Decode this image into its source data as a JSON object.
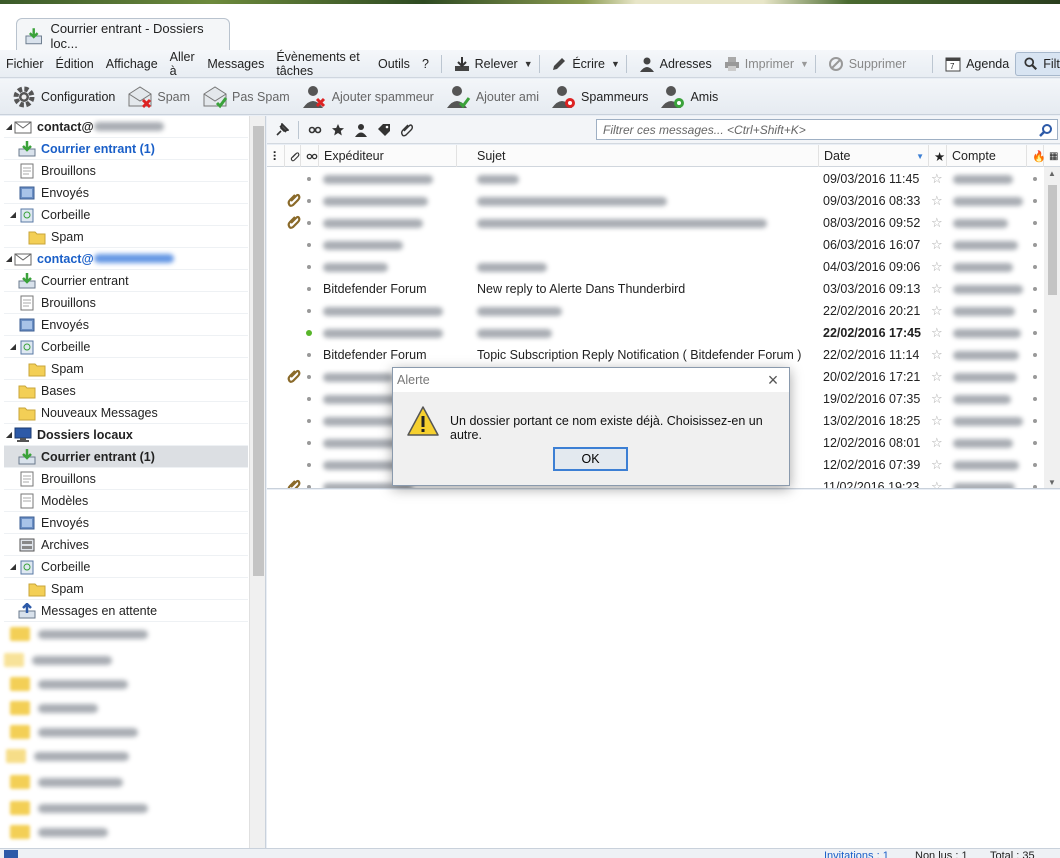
{
  "window": {
    "tab_title": "Courrier entrant - Dossiers loc..."
  },
  "menu": [
    "Fichier",
    "Édition",
    "Affichage",
    "Aller à",
    "Messages",
    "Évènements et tâches",
    "Outils",
    "?"
  ],
  "toolbar": {
    "get_mail": "Relever",
    "write": "Écrire",
    "address_book": "Adresses",
    "print": "Imprimer",
    "delete": "Supprimer",
    "calendar": "Agenda",
    "filter": "Filtre"
  },
  "ext_toolbar": {
    "config": "Configuration",
    "spam": "Spam",
    "not_spam": "Pas Spam",
    "add_spammer": "Ajouter spammeur",
    "add_friend": "Ajouter ami",
    "spammers": "Spammeurs",
    "friends": "Amis"
  },
  "folders": {
    "account1_prefix": "contact@",
    "account2_prefix": "contact@",
    "acc1_inbox": "Courrier entrant (1)",
    "acc1_drafts": "Brouillons",
    "acc1_sent": "Envoyés",
    "acc1_trash": "Corbeille",
    "acc1_spam": "Spam",
    "acc2_inbox": "Courrier entrant",
    "acc2_drafts": "Brouillons",
    "acc2_sent": "Envoyés",
    "acc2_trash": "Corbeille",
    "acc2_spam": "Spam",
    "acc2_bases": "Bases",
    "acc2_newmsgs": "Nouveaux Messages",
    "local": "Dossiers locaux",
    "local_inbox": "Courrier entrant (1)",
    "local_drafts": "Brouillons",
    "local_templates": "Modèles",
    "local_sent": "Envoyés",
    "local_archives": "Archives",
    "local_trash": "Corbeille",
    "local_spam": "Spam",
    "local_outbox": "Messages en attente"
  },
  "search": {
    "placeholder": "Filtrer ces messages... <Ctrl+Shift+K>"
  },
  "columns": {
    "sender": "Expéditeur",
    "subject": "Sujet",
    "date": "Date",
    "account": "Compte"
  },
  "messages": [
    {
      "sender": "",
      "subject": "",
      "date": "09/03/2016 11:45",
      "attach": false,
      "unread": false
    },
    {
      "sender": "",
      "subject": "",
      "date": "09/03/2016 08:33",
      "attach": true,
      "unread": false
    },
    {
      "sender": "",
      "subject": "",
      "date": "08/03/2016 09:52",
      "attach": true,
      "unread": false
    },
    {
      "sender": "",
      "subject": "",
      "date": "06/03/2016 16:07",
      "attach": false,
      "unread": false
    },
    {
      "sender": "",
      "subject": "",
      "date": "04/03/2016 09:06",
      "attach": false,
      "unread": false
    },
    {
      "sender": "Bitdefender Forum",
      "subject": "New reply to Alerte Dans Thunderbird",
      "date": "03/03/2016 09:13",
      "attach": false,
      "unread": false
    },
    {
      "sender": "",
      "subject": "",
      "date": "22/02/2016 20:21",
      "attach": false,
      "unread": false
    },
    {
      "sender": "",
      "subject": "",
      "date": "22/02/2016 17:45",
      "attach": false,
      "unread": true
    },
    {
      "sender": "Bitdefender Forum",
      "subject": "Topic Subscription Reply Notification ( Bitdefender Forum )",
      "date": "22/02/2016 11:14",
      "attach": false,
      "unread": false
    },
    {
      "sender": "",
      "subject": "",
      "date": "20/02/2016 17:21",
      "attach": true,
      "unread": false
    },
    {
      "sender": "",
      "subject": "",
      "date": "19/02/2016 07:35",
      "attach": false,
      "unread": false
    },
    {
      "sender": "",
      "subject": "",
      "date": "13/02/2016 18:25",
      "attach": false,
      "unread": false
    },
    {
      "sender": "",
      "subject": "",
      "date": "12/02/2016 08:01",
      "attach": false,
      "unread": false
    },
    {
      "sender": "",
      "subject": "",
      "date": "12/02/2016 07:39",
      "attach": false,
      "unread": false
    },
    {
      "sender": "",
      "subject": "",
      "date": "11/02/2016 19:23",
      "attach": true,
      "unread": false
    }
  ],
  "dialog": {
    "title": "Alerte",
    "message": "Un dossier portant ce nom existe déjà. Choisissez-en un autre.",
    "ok": "OK"
  },
  "status": {
    "invitations": "Invitations : 1",
    "unread": "Non lus : 1",
    "total": "Total : 35"
  },
  "colors": {
    "accent_blue": "#1a5fc8",
    "unread_dot": "#58b52a",
    "dialog_button_border": "#3c7fd4"
  }
}
